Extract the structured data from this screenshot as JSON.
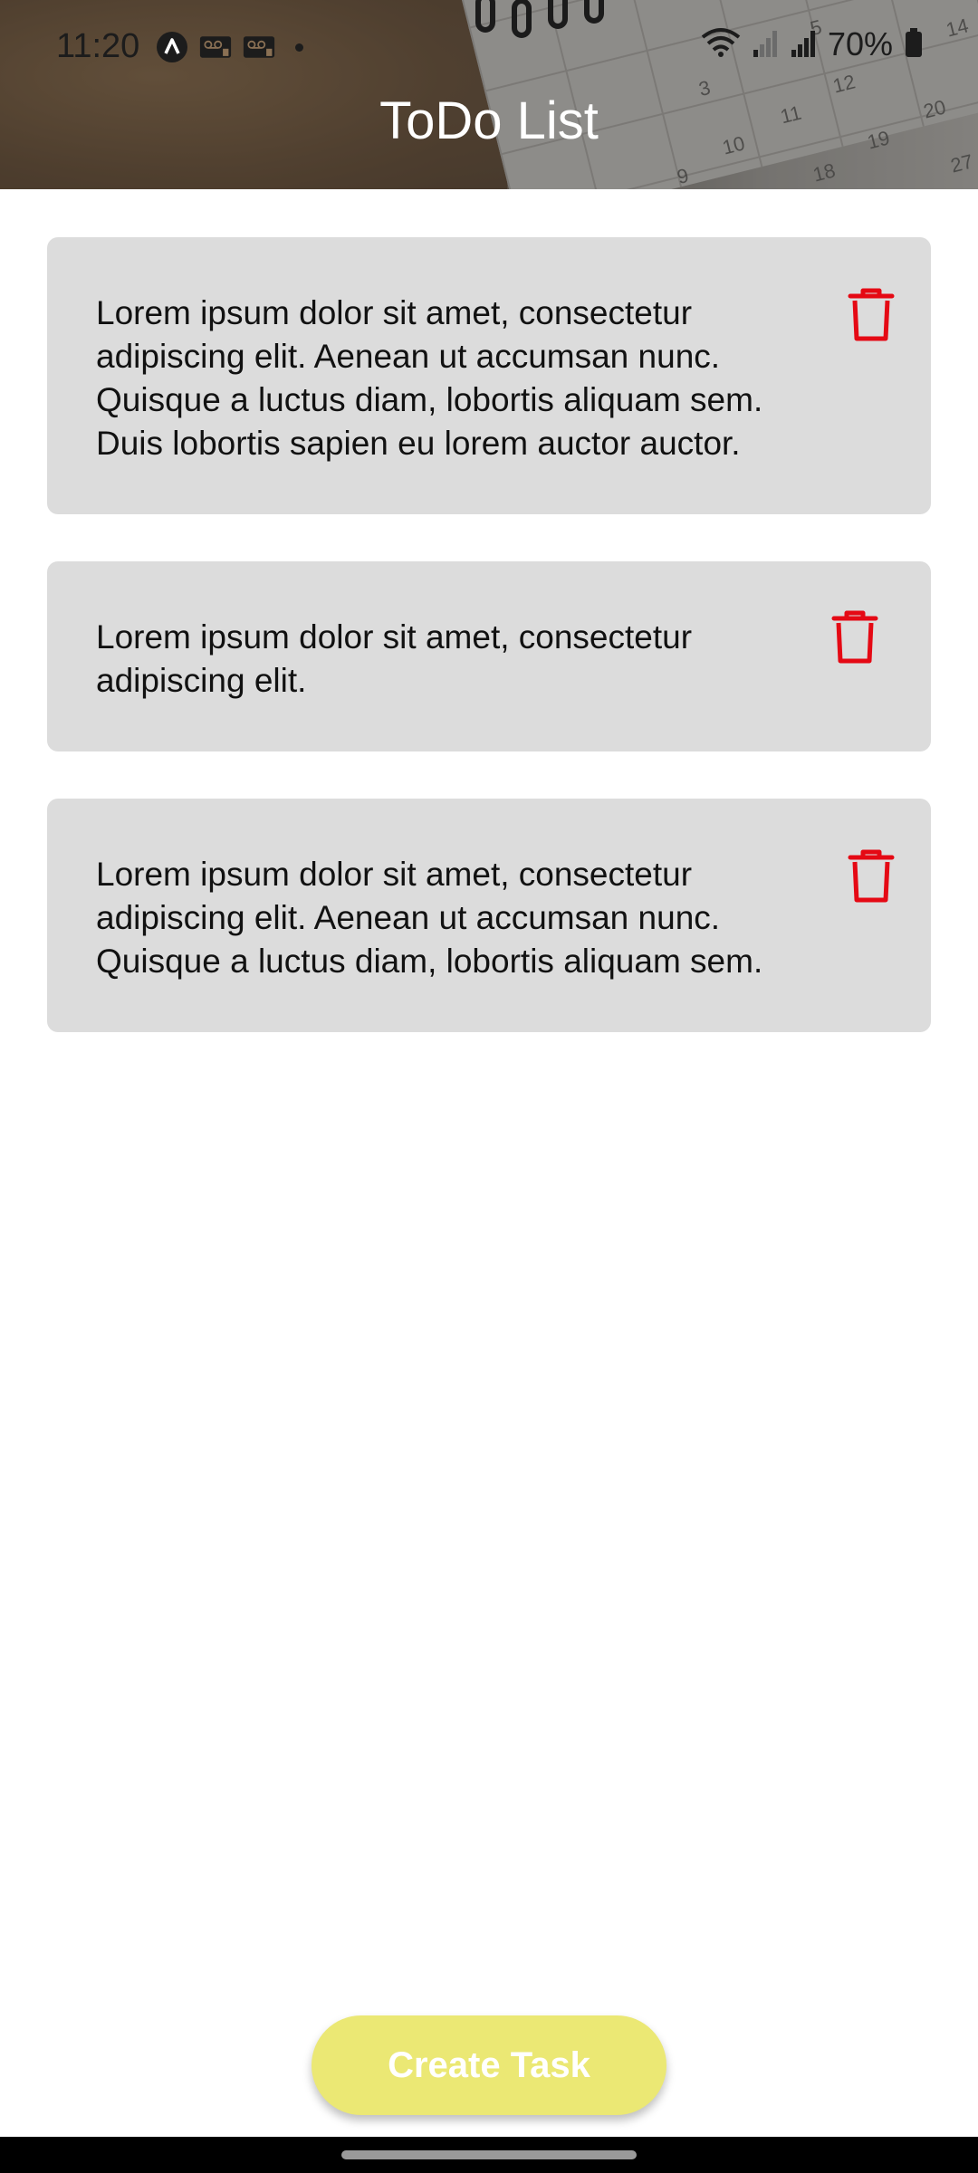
{
  "status_bar": {
    "time": "11:20",
    "battery": "70%",
    "icons_left": [
      "navigation-icon",
      "voicemail-1-icon",
      "voicemail-2-icon",
      "notification-dot"
    ],
    "icons_right": [
      "wifi-icon",
      "signal-weak-icon",
      "signal-icon",
      "battery-icon"
    ]
  },
  "header": {
    "title": "ToDo List",
    "calendar_numbers": [
      "5",
      "14",
      "3",
      "12",
      "20",
      "11",
      "19",
      "10",
      "9",
      "18",
      "27"
    ]
  },
  "tasks": [
    {
      "text": "Lorem ipsum dolor sit amet, consectetur adipiscing elit. Aenean ut accumsan nunc. Quisque a luctus diam, lobortis aliquam sem. Duis lobortis sapien eu lorem auctor auctor.",
      "delete_icon": "trash-icon"
    },
    {
      "text": "Lorem ipsum dolor sit amet, consectetur adipiscing elit.",
      "delete_icon": "trash-icon"
    },
    {
      "text": "Lorem ipsum dolor sit amet, consectetur adipiscing elit. Aenean ut accumsan nunc. Quisque a luctus diam, lobortis aliquam sem.",
      "delete_icon": "trash-icon"
    }
  ],
  "actions": {
    "create_task_label": "Create Task"
  },
  "colors": {
    "card_background": "#dcdcdc",
    "delete_icon": "#e50914",
    "create_button": "#ebe874",
    "title_text": "#ffffff"
  }
}
